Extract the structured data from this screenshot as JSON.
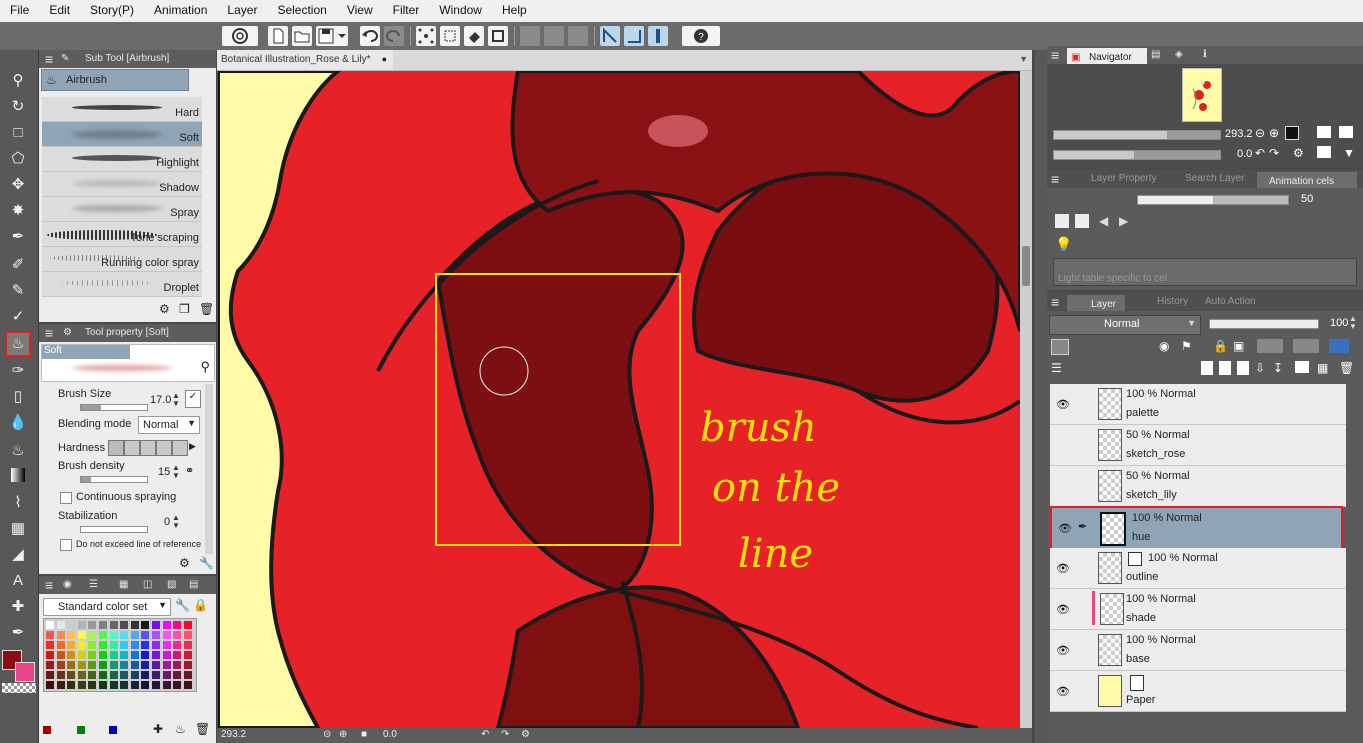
{
  "menu": [
    "File",
    "Edit",
    "Story(P)",
    "Animation",
    "Layer",
    "Selection",
    "View",
    "Filter",
    "Window",
    "Help"
  ],
  "subtool": {
    "tab": "Sub Tool [Airbrush]",
    "group": "Airbrush",
    "brushes": [
      "Hard",
      "Soft",
      "Highlight",
      "Shadow",
      "Spray",
      "Tone scraping",
      "Running color spray",
      "Droplet"
    ],
    "selected": "Soft"
  },
  "toolprop": {
    "tab": "Tool property [Soft]",
    "name": "Soft",
    "brush_size_label": "Brush Size",
    "brush_size": "17.0",
    "blending_label": "Blending mode",
    "blending": "Normal",
    "hardness_label": "Hardness",
    "density_label": "Brush density",
    "density": "15",
    "continuous_label": "Continuous spraying",
    "stabilization_label": "Stabilization",
    "stabilization": "0",
    "no_exceed_label": "Do not exceed line of reference"
  },
  "colorset": {
    "name": "Standard color set"
  },
  "colors": {
    "main": "#8b0f12",
    "sub": "#e8458a",
    "accent": "#e02020",
    "selected_row": "#8fa5b5"
  },
  "document": {
    "tab": "Botanical Illustration_Rose & Lily*"
  },
  "status": {
    "zoom": "293.2",
    "angle": "0.0"
  },
  "annotation": {
    "line1": "brush",
    "line2": "on the",
    "line3": "line"
  },
  "navigator": {
    "tab": "Navigator",
    "zoom": "293.2",
    "angle": "0.0"
  },
  "anim": {
    "tabs": [
      "Layer Property",
      "Search Layer",
      "Animation cels"
    ],
    "opacity": "50",
    "lighttable_placeholder": "Light table specific to cel"
  },
  "layerpanel": {
    "tabs": [
      "Layer",
      "History",
      "Auto Action"
    ],
    "blend": "Normal",
    "opacity": "100",
    "layers": [
      {
        "mode": "100 % Normal",
        "name": "palette"
      },
      {
        "mode": "50 % Normal",
        "name": "sketch_rose"
      },
      {
        "mode": "50 % Normal",
        "name": "sketch_lily"
      },
      {
        "mode": "100 % Normal",
        "name": "hue"
      },
      {
        "mode": "100 % Normal",
        "name": "outline"
      },
      {
        "mode": "100 % Normal",
        "name": "shade"
      },
      {
        "mode": "100 % Normal",
        "name": "base"
      },
      {
        "mode": "",
        "name": "Paper"
      }
    ]
  }
}
